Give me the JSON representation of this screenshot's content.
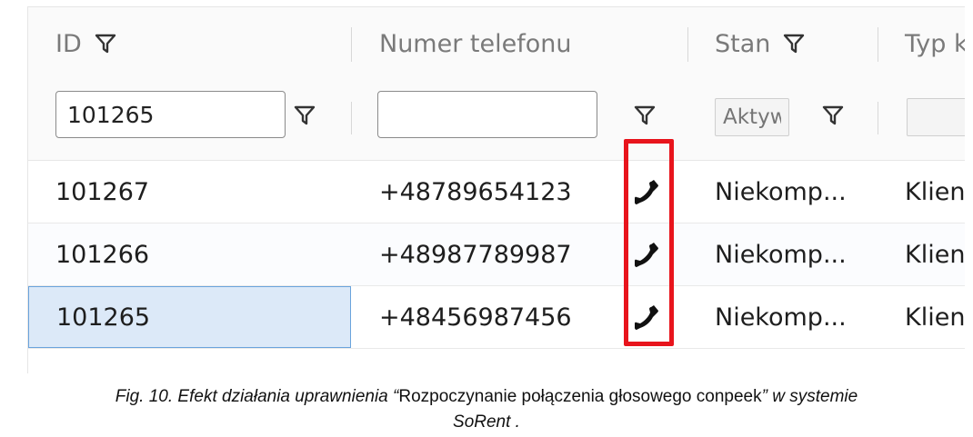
{
  "grid": {
    "columns": [
      {
        "id": "id",
        "label": "ID",
        "filterable_header": true
      },
      {
        "id": "phone",
        "label": "Numer telefonu",
        "filterable_header": false
      },
      {
        "id": "state",
        "label": "Stan",
        "filterable_header": true
      },
      {
        "id": "type",
        "label": "Typ k",
        "filterable_header": false
      }
    ],
    "filters": {
      "id_value": "101265",
      "phone_value": "",
      "state_placeholder": "Aktyw",
      "type_value": ""
    },
    "rows": [
      {
        "id": "101267",
        "phone": "+48789654123",
        "state": "Niekomp...",
        "type": "Klien",
        "selected": false
      },
      {
        "id": "101266",
        "phone": "+48987789987",
        "state": "Niekomp...",
        "type": "Klien",
        "selected": false
      },
      {
        "id": "101265",
        "phone": "+48456987456",
        "state": "Niekomp...",
        "type": "Klien",
        "selected": true
      }
    ],
    "icons": {
      "filter": "filter-funnel-icon",
      "call": "phone-handset-icon"
    },
    "colors": {
      "highlight": "#e8141c",
      "selection": "#dce9f8",
      "selection_border": "#6aa3dc"
    }
  },
  "caption": {
    "part1": "Fig. 10. Efekt działania uprawnienia “",
    "part2": "Rozpoczynanie połączenia głosowego conpeek",
    "part3": "” w systemie",
    "part4": "SoRent",
    "part5": " ."
  }
}
